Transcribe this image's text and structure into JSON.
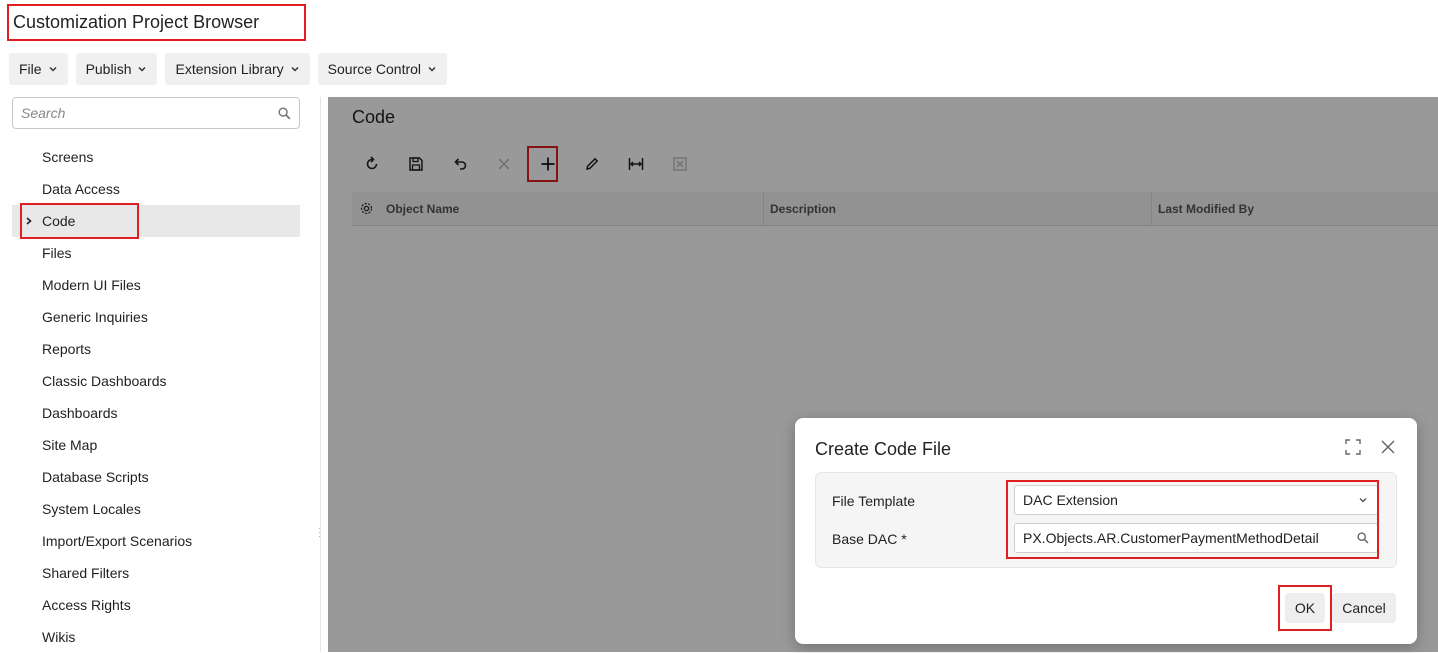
{
  "app": {
    "title": "Customization Project Browser"
  },
  "menu": [
    {
      "label": "File",
      "icon": "chevron-down-icon"
    },
    {
      "label": "Publish",
      "icon": "chevron-down-icon"
    },
    {
      "label": "Extension Library",
      "icon": "chevron-down-icon"
    },
    {
      "label": "Source Control",
      "icon": "chevron-down-icon"
    }
  ],
  "search": {
    "placeholder": "Search",
    "icon": "search-icon"
  },
  "tree": {
    "items": [
      {
        "label": "Screens"
      },
      {
        "label": "Data Access"
      },
      {
        "label": "Code",
        "selected": true
      },
      {
        "label": "Files"
      },
      {
        "label": "Modern UI Files"
      },
      {
        "label": "Generic Inquiries"
      },
      {
        "label": "Reports"
      },
      {
        "label": "Classic Dashboards"
      },
      {
        "label": "Dashboards"
      },
      {
        "label": "Site Map"
      },
      {
        "label": "Database Scripts"
      },
      {
        "label": "System Locales"
      },
      {
        "label": "Import/Export Scenarios"
      },
      {
        "label": "Shared Filters"
      },
      {
        "label": "Access Rights"
      },
      {
        "label": "Wikis"
      }
    ]
  },
  "main": {
    "title": "Code",
    "toolbar": [
      "refresh-icon",
      "save-icon",
      "undo-icon",
      "delete-icon",
      "add-icon",
      "edit-icon",
      "fit-width-icon",
      "export-excel-icon"
    ],
    "grid": {
      "columns": [
        "Object Name",
        "Description",
        "Last Modified By"
      ]
    }
  },
  "dialog": {
    "title": "Create Code File",
    "fields": {
      "file_template": {
        "label": "File Template",
        "value": "DAC Extension"
      },
      "base_dac": {
        "label": "Base DAC *",
        "value": "PX.Objects.AR.CustomerPaymentMethodDetail"
      }
    },
    "ok_label": "OK",
    "cancel_label": "Cancel"
  },
  "colors": {
    "highlight": "#e02020",
    "overlay": "rgba(0,0,0,0.40)"
  }
}
